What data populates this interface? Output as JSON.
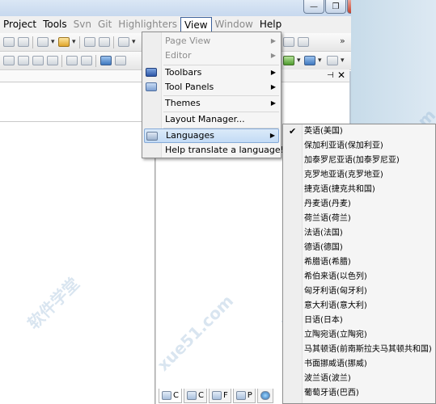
{
  "window": {
    "minimize_glyph": "—",
    "restore_glyph": "❐",
    "close_glyph": "✕"
  },
  "menubar": {
    "items": [
      "Project",
      "Tools",
      "Svn",
      "Git",
      "Highlighters",
      "View",
      "Window",
      "Help"
    ],
    "open_item": "View",
    "overflow_glyph": "»"
  },
  "view_menu": {
    "items": [
      {
        "label": "Page View",
        "enabled": false,
        "submenu": true
      },
      {
        "label": "Editor",
        "enabled": false,
        "submenu": true
      },
      {
        "label": "Toolbars",
        "enabled": true,
        "submenu": true,
        "icon": "toolbars-icon"
      },
      {
        "label": "Tool Panels",
        "enabled": true,
        "submenu": true,
        "icon": "tool-panels-icon"
      },
      {
        "label": "Themes",
        "enabled": true,
        "submenu": true
      },
      {
        "label": "Layout Manager...",
        "enabled": true,
        "submenu": false
      },
      {
        "label": "Languages",
        "enabled": true,
        "submenu": true,
        "icon": "languages-icon",
        "highlighted": true
      },
      {
        "label": "Help translate a language!",
        "enabled": true,
        "submenu": false
      }
    ],
    "submenu_arrow": "▶"
  },
  "languages_menu": {
    "checked": "英语(美国)",
    "check_glyph": "✔",
    "items": [
      "英语(美国)",
      "保加利亚语(保加利亚)",
      "加泰罗尼亚语(加泰罗尼亚)",
      "克罗地亚语(克罗地亚)",
      "捷克语(捷克共和国)",
      "丹麦语(丹麦)",
      "荷兰语(荷兰)",
      "法语(法国)",
      "德语(德国)",
      "希腊语(希腊)",
      "希伯来语(以色列)",
      "匈牙利语(匈牙利)",
      "意大利语(意大利)",
      "日语(日本)",
      "立陶宛语(立陶宛)",
      "马其顿语(前南斯拉夫马其顿共和国)",
      "书面挪威语(挪威)",
      "波兰语(波兰)",
      "葡萄牙语(巴西)"
    ]
  },
  "panel": {
    "pin_glyph": "⊣",
    "close_glyph": "✕",
    "tabs": [
      {
        "label": "C",
        "icon": "code-icon"
      },
      {
        "label": "C",
        "icon": "clips-icon"
      },
      {
        "label": "F",
        "icon": "files-icon"
      },
      {
        "label": "P",
        "icon": "project-icon"
      },
      {
        "label": "",
        "icon": "web-icon"
      }
    ]
  },
  "watermark": [
    "软件学堂",
    "xue51.com"
  ]
}
